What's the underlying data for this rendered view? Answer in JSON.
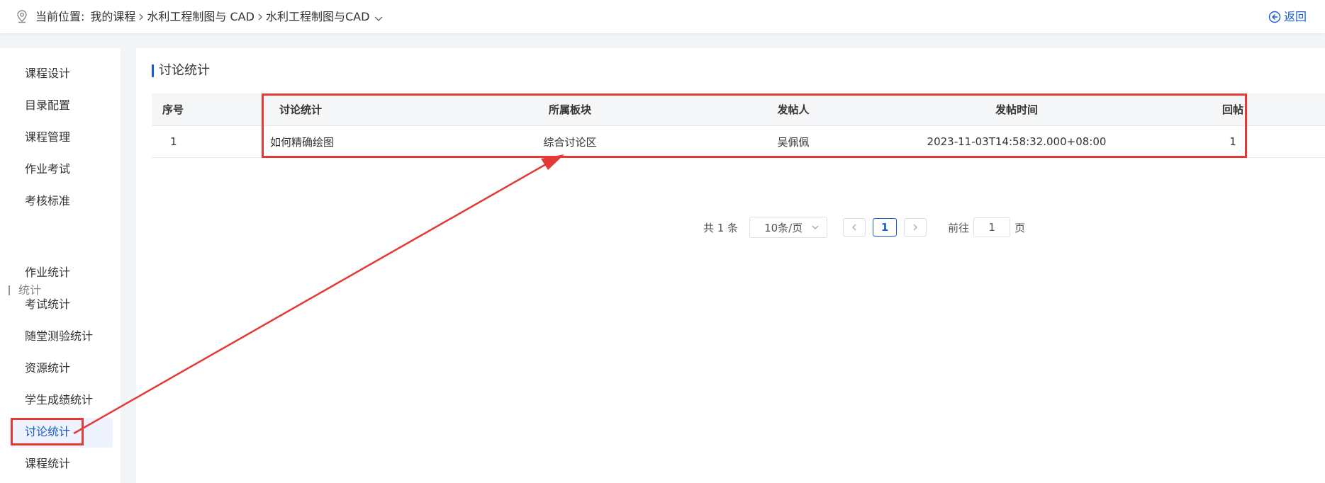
{
  "breadcrumb": {
    "prefix": "当前位置:",
    "items": [
      "我的课程",
      "水利工程制图与 CAD",
      "水利工程制图与CAD"
    ],
    "back_label": "返回"
  },
  "sidebar": {
    "items_top": [
      "课程设计",
      "目录配置",
      "课程管理",
      "作业考试",
      "考核标准"
    ],
    "group_label": "统计",
    "items_stats": [
      "作业统计",
      "考试统计",
      "随堂测验统计",
      "资源统计",
      "学生成绩统计",
      "讨论统计",
      "课程统计"
    ],
    "active": "讨论统计"
  },
  "main": {
    "section_title": "讨论统计",
    "table": {
      "headers": [
        "序号",
        "讨论统计",
        "所属板块",
        "发帖人",
        "发帖时间",
        "回帖"
      ],
      "rows": [
        [
          "1",
          "如何精确绘图",
          "综合讨论区",
          "吴佩佩",
          "2023-11-03T14:58:32.000+08:00",
          "1"
        ]
      ]
    },
    "pagination": {
      "total": "共 1 条",
      "page_size": "10条/页",
      "current_page": "1",
      "goto_prefix": "前往",
      "goto_value": "1",
      "goto_suffix": "页"
    }
  },
  "colors": {
    "accent": "#1a5cd1",
    "annotation": "#e53935"
  }
}
